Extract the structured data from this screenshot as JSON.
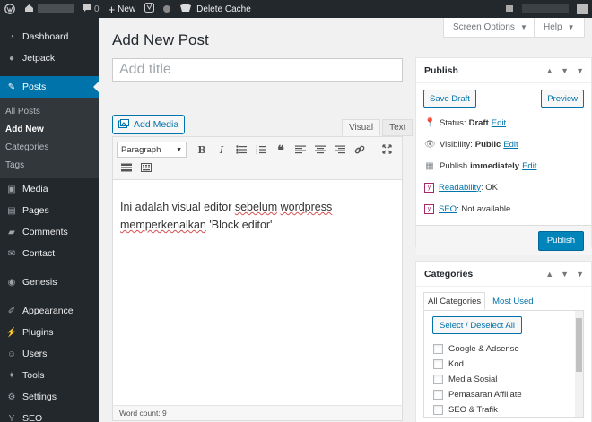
{
  "adminbar": {
    "comments_count": "0",
    "new_label": "New",
    "delete_cache_label": "Delete Cache"
  },
  "sidebar": {
    "items": [
      {
        "label": "Dashboard",
        "icon": "dashboard-icon"
      },
      {
        "label": "Jetpack",
        "icon": "jetpack-icon"
      },
      {
        "label": "Posts",
        "icon": "pin-icon"
      },
      {
        "label": "Media",
        "icon": "media-icon"
      },
      {
        "label": "Pages",
        "icon": "pages-icon"
      },
      {
        "label": "Comments",
        "icon": "comments-icon"
      },
      {
        "label": "Contact",
        "icon": "contact-icon"
      },
      {
        "label": "Genesis",
        "icon": "genesis-icon"
      },
      {
        "label": "Appearance",
        "icon": "appearance-icon"
      },
      {
        "label": "Plugins",
        "icon": "plugins-icon"
      },
      {
        "label": "Users",
        "icon": "users-icon"
      },
      {
        "label": "Tools",
        "icon": "tools-icon"
      },
      {
        "label": "Settings",
        "icon": "settings-icon"
      },
      {
        "label": "SEO",
        "icon": "seo-icon"
      }
    ],
    "posts_submenu": [
      "All Posts",
      "Add New",
      "Categories",
      "Tags"
    ]
  },
  "header": {
    "screen_options": "Screen Options",
    "help": "Help",
    "page_title": "Add New Post"
  },
  "editor": {
    "title_placeholder": "Add title",
    "add_media": "Add Media",
    "tab_visual": "Visual",
    "tab_text": "Text",
    "format_select": "Paragraph",
    "content_line1_a": "Ini adalah visual editor ",
    "content_line1_b": "sebelum",
    "content_line1_c": " ",
    "content_line1_d": "wordpress",
    "content_line2_a": "memperkenalkan",
    "content_line2_b": " 'Block editor'",
    "word_count": "Word count: 9"
  },
  "publish_box": {
    "title": "Publish",
    "save_draft": "Save Draft",
    "preview": "Preview",
    "status_label": "Status:",
    "status_value": "Draft",
    "visibility_label": "Visibility:",
    "visibility_value": "Public",
    "publish_label": "Publish",
    "publish_value": "immediately",
    "edit": "Edit",
    "readability_label": "Readability",
    "readability_value": ": OK",
    "seo_label": "SEO",
    "seo_value": ": Not available",
    "publish_button": "Publish"
  },
  "categories_box": {
    "title": "Categories",
    "tab_all": "All Categories",
    "tab_most_used": "Most Used",
    "select_all": "Select / Deselect All",
    "items": [
      "Google & Adsense",
      "Kod",
      "Media Sosial",
      "Pemasaran Affiliate",
      "SEO & Trafik"
    ]
  },
  "colors": {
    "adminbar_bg": "#23282d",
    "accent": "#0073aa",
    "primary_button": "#0085ba"
  }
}
